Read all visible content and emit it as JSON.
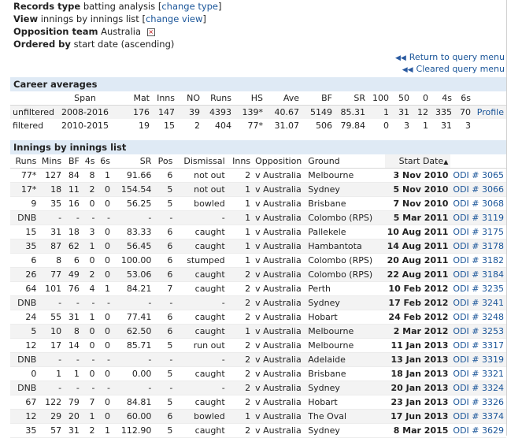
{
  "query": {
    "records_type_label": "Records type",
    "records_type_value": "batting analysis",
    "change_type": "change type",
    "view_label": "View",
    "view_value": "innings by innings list",
    "change_view": "change view",
    "opposition_label": "Opposition team",
    "opposition_value": "Australia",
    "remove_icon_glyph": "×",
    "ordered_label": "Ordered by",
    "ordered_value": "start date (ascending)"
  },
  "nav": {
    "return": "Return to query menu",
    "cleared": "Cleared query menu"
  },
  "career": {
    "title": "Career averages",
    "headers": [
      "",
      "Span",
      "Mat",
      "Inns",
      "NO",
      "Runs",
      "HS",
      "Ave",
      "BF",
      "SR",
      "100",
      "50",
      "0",
      "4s",
      "6s",
      ""
    ],
    "rows": [
      [
        "unfiltered",
        "2008-2016",
        "176",
        "147",
        "39",
        "4393",
        "139*",
        "40.67",
        "5149",
        "85.31",
        "1",
        "31",
        "12",
        "335",
        "70",
        "Profile"
      ],
      [
        "filtered",
        "2010-2015",
        "19",
        "15",
        "2",
        "404",
        "77*",
        "31.07",
        "506",
        "79.84",
        "0",
        "3",
        "1",
        "31",
        "3",
        ""
      ]
    ]
  },
  "innings": {
    "title": "Innings by innings list",
    "headers": [
      "Runs",
      "Mins",
      "BF",
      "4s",
      "6s",
      "SR",
      "Pos",
      "Dismissal",
      "Inns",
      "Opposition",
      "Ground",
      "Start Date",
      ""
    ],
    "sort_icon": "▲",
    "rows": [
      [
        "77*",
        "127",
        "84",
        "8",
        "1",
        "91.66",
        "6",
        "not out",
        "2",
        "v Australia",
        "Melbourne",
        "3 Nov 2010",
        "ODI # 3065"
      ],
      [
        "17*",
        "18",
        "11",
        "2",
        "0",
        "154.54",
        "5",
        "not out",
        "1",
        "v Australia",
        "Sydney",
        "5 Nov 2010",
        "ODI # 3066"
      ],
      [
        "9",
        "35",
        "16",
        "0",
        "0",
        "56.25",
        "5",
        "bowled",
        "1",
        "v Australia",
        "Brisbane",
        "7 Nov 2010",
        "ODI # 3068"
      ],
      [
        "DNB",
        "-",
        "-",
        "-",
        "-",
        "-",
        "-",
        "-",
        "1",
        "v Australia",
        "Colombo (RPS)",
        "5 Mar 2011",
        "ODI # 3119"
      ],
      [
        "15",
        "31",
        "18",
        "3",
        "0",
        "83.33",
        "6",
        "caught",
        "1",
        "v Australia",
        "Pallekele",
        "10 Aug 2011",
        "ODI # 3175"
      ],
      [
        "35",
        "87",
        "62",
        "1",
        "0",
        "56.45",
        "6",
        "caught",
        "1",
        "v Australia",
        "Hambantota",
        "14 Aug 2011",
        "ODI # 3178"
      ],
      [
        "6",
        "8",
        "6",
        "0",
        "0",
        "100.00",
        "6",
        "stumped",
        "1",
        "v Australia",
        "Colombo (RPS)",
        "20 Aug 2011",
        "ODI # 3182"
      ],
      [
        "26",
        "77",
        "49",
        "2",
        "0",
        "53.06",
        "6",
        "caught",
        "2",
        "v Australia",
        "Colombo (RPS)",
        "22 Aug 2011",
        "ODI # 3184"
      ],
      [
        "64",
        "101",
        "76",
        "4",
        "1",
        "84.21",
        "7",
        "caught",
        "2",
        "v Australia",
        "Perth",
        "10 Feb 2012",
        "ODI # 3235"
      ],
      [
        "DNB",
        "-",
        "-",
        "-",
        "-",
        "-",
        "-",
        "-",
        "2",
        "v Australia",
        "Sydney",
        "17 Feb 2012",
        "ODI # 3241"
      ],
      [
        "24",
        "55",
        "31",
        "1",
        "0",
        "77.41",
        "6",
        "caught",
        "2",
        "v Australia",
        "Hobart",
        "24 Feb 2012",
        "ODI # 3248"
      ],
      [
        "5",
        "10",
        "8",
        "0",
        "0",
        "62.50",
        "6",
        "caught",
        "1",
        "v Australia",
        "Melbourne",
        "2 Mar 2012",
        "ODI # 3253"
      ],
      [
        "12",
        "17",
        "14",
        "0",
        "0",
        "85.71",
        "5",
        "run out",
        "2",
        "v Australia",
        "Melbourne",
        "11 Jan 2013",
        "ODI # 3317"
      ],
      [
        "DNB",
        "-",
        "-",
        "-",
        "-",
        "-",
        "-",
        "-",
        "2",
        "v Australia",
        "Adelaide",
        "13 Jan 2013",
        "ODI # 3319"
      ],
      [
        "0",
        "1",
        "1",
        "0",
        "0",
        "0.00",
        "5",
        "caught",
        "2",
        "v Australia",
        "Brisbane",
        "18 Jan 2013",
        "ODI # 3321"
      ],
      [
        "DNB",
        "-",
        "-",
        "-",
        "-",
        "-",
        "-",
        "-",
        "2",
        "v Australia",
        "Sydney",
        "20 Jan 2013",
        "ODI # 3324"
      ],
      [
        "67",
        "122",
        "79",
        "7",
        "0",
        "84.81",
        "5",
        "caught",
        "2",
        "v Australia",
        "Hobart",
        "23 Jan 2013",
        "ODI # 3326"
      ],
      [
        "12",
        "29",
        "20",
        "1",
        "0",
        "60.00",
        "6",
        "bowled",
        "1",
        "v Australia",
        "The Oval",
        "17 Jun 2013",
        "ODI # 3374"
      ],
      [
        "35",
        "57",
        "31",
        "2",
        "1",
        "112.90",
        "5",
        "caught",
        "2",
        "v Australia",
        "Sydney",
        "8 Mar 2015",
        "ODI # 3629"
      ]
    ]
  },
  "colors": {
    "link": "#1a5599",
    "section_header_bg": "#dfeaf5",
    "alt_row_bg": "#f3f3f3"
  }
}
